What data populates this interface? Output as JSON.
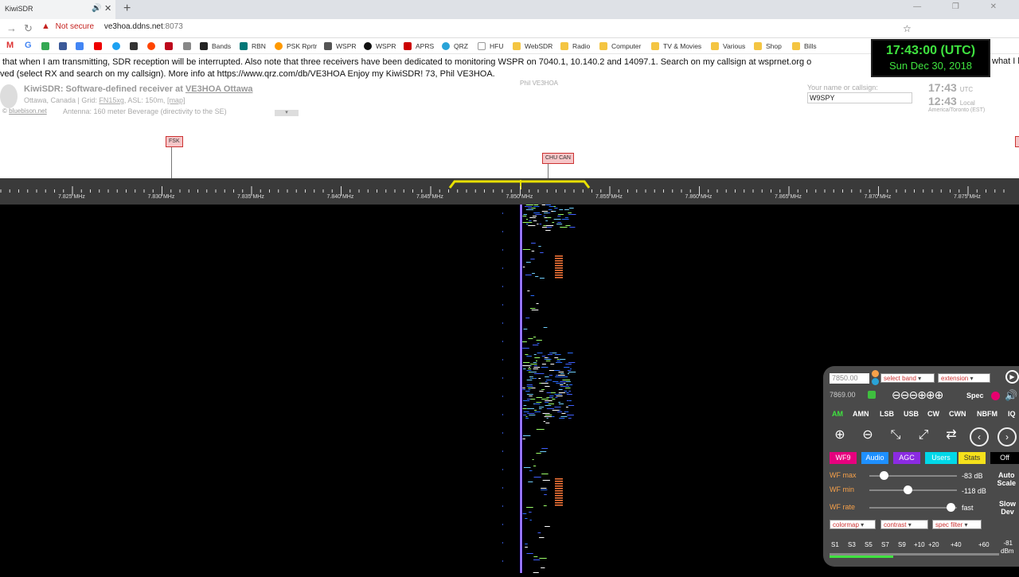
{
  "browser": {
    "tab_title": "KiwiSDR",
    "security_label": "Not secure",
    "host": "ve3hoa.ddns.net",
    "port": ":8073",
    "bookmarks": [
      "Bands",
      "RBN",
      "PSK Rprtr",
      "WSPR",
      "WSPR",
      "APRS",
      "QRZ",
      "HFU",
      "WebSDR",
      "Radio",
      "Computer",
      "TV & Movies",
      "Various",
      "Shop",
      "Bills"
    ]
  },
  "notice": {
    "line1": "that when I am transmitting, SDR reception will be interrupted. Also note that three receivers have been dedicated to monitoring WSPR on 7040.1, 10.140.2 and 14097.1. Search on my callsign at wsprnet.org o",
    "line1_tail": "what I h",
    "line2": "ved (select RX and search on my callsign). More info at https://www.qrz.com/db/VE3HOA Enjoy my KiwiSDR! 73, Phil VE3HOA."
  },
  "clock": {
    "time": "17:43:00 (UTC)",
    "date": "Sun Dec 30, 2018"
  },
  "header": {
    "title_prefix": "KiwiSDR: Software-defined receiver at ",
    "title_link": "VE3HOA Ottawa",
    "location_prefix": "Ottawa, Canada | Grid: ",
    "grid": "FN15xg",
    "location_suffix": ", ASL: 150m, ",
    "map_link": "[map]",
    "attribution_prefix": "© ",
    "attribution_link": "bluebison.net",
    "antenna": "Antenna: 160 meter Beverage (directivity to the SE)",
    "owner": "Phil VE3HOA",
    "name_label": "Your name or callsign:",
    "name_value": "W9SPY",
    "utc_time": "17:43",
    "utc_label": "UTC",
    "local_time": "12:43",
    "local_label": "Local",
    "timezone": "America/Toronto (EST)"
  },
  "dx_labels": [
    {
      "label": "FSK"
    },
    {
      "label": "CHU CAN"
    }
  ],
  "scale_ticks": [
    "7.825 MHz",
    "7.830 MHz",
    "7.835 MHz",
    "7.840 MHz",
    "7.845 MHz",
    "7.850 MHz",
    "7.855 MHz",
    "7.860 MHz",
    "7.865 MHz",
    "7.870 MHz",
    "7.875 MHz"
  ],
  "panel": {
    "frequency": "7850.00",
    "band_select": "select band",
    "extension_select": "extension",
    "freq_readout": "7869.00",
    "spec_label": "Spec",
    "modes": [
      "AM",
      "AMN",
      "LSB",
      "USB",
      "CW",
      "CWN",
      "NBFM",
      "IQ"
    ],
    "tabs": [
      {
        "label": "WF9",
        "bg": "#e6007e",
        "fg": "#ffffff"
      },
      {
        "label": "Audio",
        "bg": "#1e90ff",
        "fg": "#ffffff"
      },
      {
        "label": "AGC",
        "bg": "#8b2be2",
        "fg": "#ffffff"
      },
      {
        "label": "Users",
        "bg": "#00d8e8",
        "fg": "#ffffff"
      },
      {
        "label": "Stats",
        "bg": "#f5e11b",
        "fg": "#333333"
      },
      {
        "label": "Off",
        "bg": "#000000",
        "fg": "#ffffff"
      }
    ],
    "wf_max_label": "WF max",
    "wf_max_value": "-83 dB",
    "wf_min_label": "WF min",
    "wf_min_value": "-118 dB",
    "wf_rate_label": "WF rate",
    "wf_rate_value": "fast",
    "auto_scale_1": "Auto",
    "auto_scale_2": "Scale",
    "slow_dev_1": "Slow",
    "slow_dev_2": "Dev",
    "colormap_select": "colormap",
    "contrast_select": "contrast",
    "spec_filter_select": "spec filter",
    "smeter_ticks": [
      "S1",
      "S3",
      "S5",
      "S7",
      "S9",
      "+10",
      "+20",
      "+40",
      "+60"
    ],
    "smeter_value": "-81",
    "smeter_unit": "dBm"
  },
  "colors": {
    "accent_yellow": "#e8e000",
    "clock_green": "#3fe33f",
    "label_orange": "#f7a14a"
  }
}
